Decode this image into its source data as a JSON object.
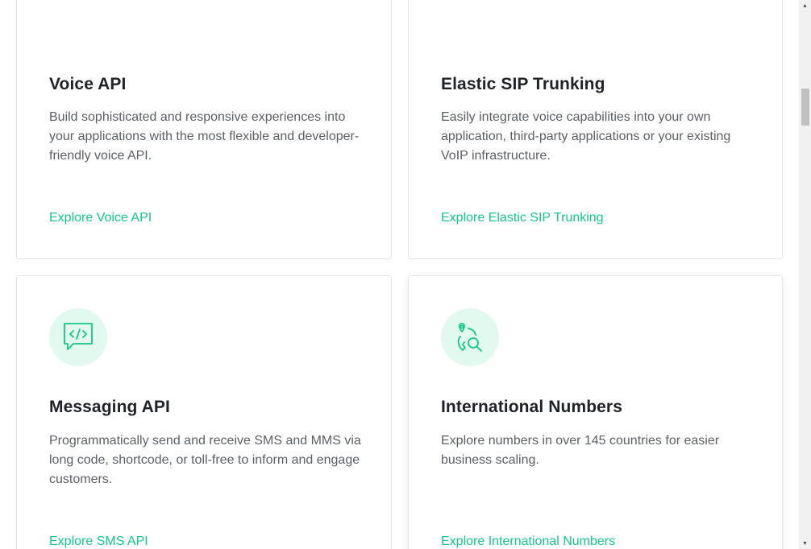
{
  "cards": [
    {
      "title": "Voice API",
      "description": "Build sophisticated and responsive experiences into your applications with the most flexible and developer-friendly voice API.",
      "link": "Explore Voice API"
    },
    {
      "title": "Elastic SIP Trunking",
      "description": "Easily integrate voice capabilities into your own application, third-party applications or your existing VoIP infrastructure.",
      "link": "Explore Elastic SIP Trunking"
    },
    {
      "title": "Messaging API",
      "icon": "code-chat-bubble-icon",
      "description": "Programmatically send and receive SMS and MMS via long code, shortcode, or toll-free to inform and engage customers.",
      "link": "Explore SMS API"
    },
    {
      "title": "International Numbers",
      "icon": "location-phone-search-icon",
      "description": "Explore numbers in over 145 countries for easier business scaling.",
      "link": "Explore International Numbers"
    }
  ],
  "colors": {
    "accent": "#14c88a",
    "icon_bg": "#e2f9ef",
    "title": "#1f2329",
    "text": "#5b6068",
    "border": "#e3e5e8"
  },
  "scrollbar": {
    "up_arrow": "▲",
    "down_arrow": "▼"
  }
}
